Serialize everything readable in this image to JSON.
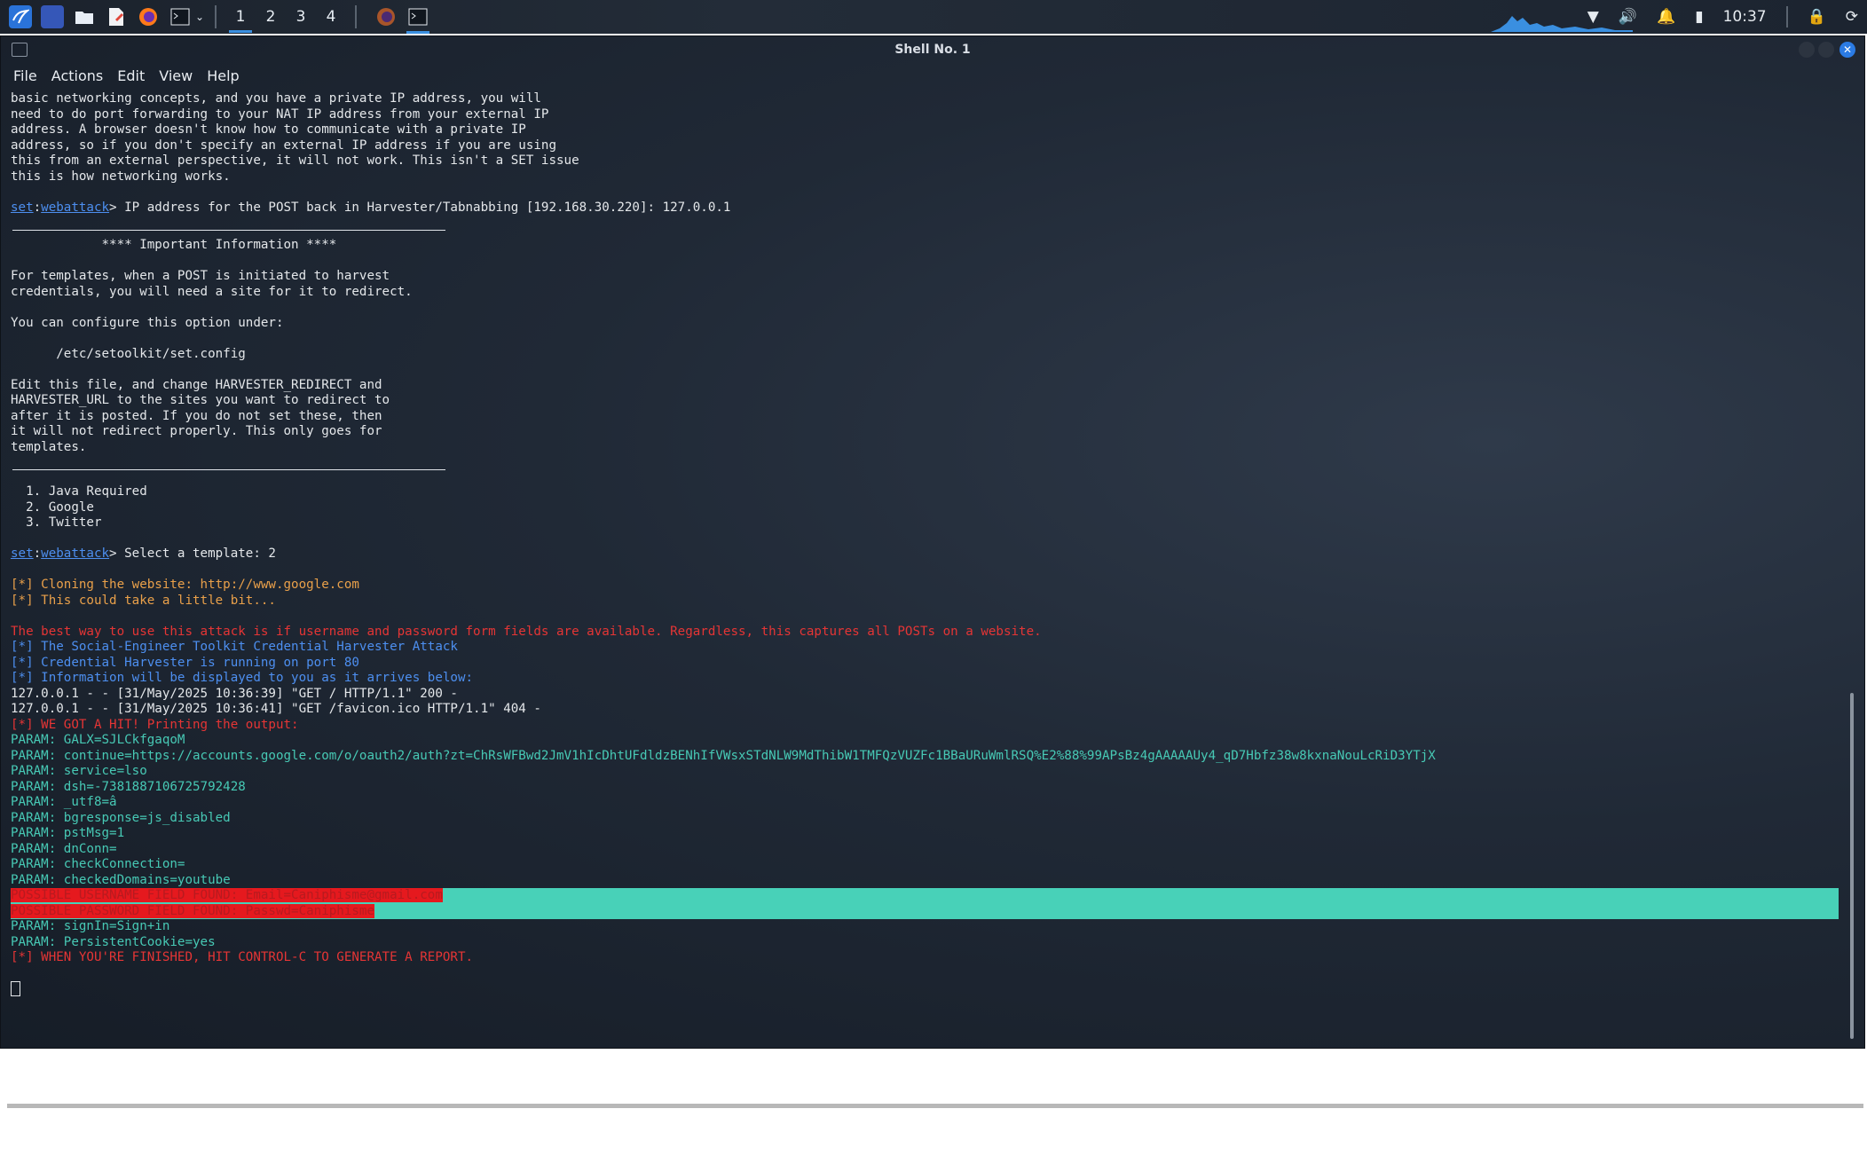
{
  "taskbar": {
    "workspaces": [
      "1",
      "2",
      "3",
      "4"
    ],
    "time": "10:37"
  },
  "window": {
    "title": "Shell No. 1",
    "menu": [
      "File",
      "Actions",
      "Edit",
      "View",
      "Help"
    ]
  },
  "terminal": {
    "intro": [
      "basic networking concepts, and you have a private IP address, you will",
      "need to do port forwarding to your NAT IP address from your external IP",
      "address. A browser doesn't know how to communicate with a private IP",
      "address, so if you don't specify an external IP address if you are using",
      "this from an external perspective, it will not work. This isn't a SET issue",
      "this is how networking works."
    ],
    "prompt_set": "set",
    "prompt_webattack": "webattack",
    "ip_prompt_text": "> IP address for the POST back in Harvester/Tabnabbing [192.168.30.220]: 127.0.0.1",
    "important_header": "            **** Important Information ****",
    "info_1": "For templates, when a POST is initiated to harvest",
    "info_2": "credentials, you will need a site for it to redirect.",
    "info_3": "You can configure this option under:",
    "config_path": "      /etc/setoolkit/set.config",
    "edit_lines": [
      "Edit this file, and change HARVESTER_REDIRECT and",
      "HARVESTER_URL to the sites you want to redirect to",
      "after it is posted. If you do not set these, then",
      "it will not redirect properly. This only goes for",
      "templates."
    ],
    "templates": [
      "  1. Java Required",
      "  2. Google",
      "  3. Twitter"
    ],
    "select_prompt_text": "> Select a template: 2",
    "cloning_lines": [
      "[*] Cloning the website: http://www.google.com",
      "[*] This could take a little bit..."
    ],
    "best_way_line": "The best way to use this attack is if username and password form fields are available. Regardless, this captures all POSTs on a website.",
    "status_lines": [
      "[*] The Social-Engineer Toolkit Credential Harvester Attack",
      "[*] Credential Harvester is running on port 80",
      "[*] Information will be displayed to you as it arrives below:"
    ],
    "log_lines": [
      "127.0.0.1 - - [31/May/2025 10:36:39] \"GET / HTTP/1.1\" 200 -",
      "127.0.0.1 - - [31/May/2025 10:36:41] \"GET /favicon.ico HTTP/1.1\" 404 -"
    ],
    "hit_line": "[*] WE GOT A HIT! Printing the output:",
    "params": [
      "PARAM: GALX=SJLCkfgaqoM",
      "PARAM: continue=https://accounts.google.com/o/oauth2/auth?zt=ChRsWFBwd2JmV1hIcDhtUFdldzBENhIfVWsxSTdNLW9MdThibW1TMFQzVUZFc1BBaURuWmlRSQ%E2%88%99APsBz4gAAAAAUy4_qD7Hbfz38w8kxnaNouLcRiD3YTjX",
      "PARAM: service=lso",
      "PARAM: dsh=-7381887106725792428",
      "PARAM: _utf8=â",
      "PARAM: bgresponse=js_disabled",
      "PARAM: pstMsg=1",
      "PARAM: dnConn=",
      "PARAM: checkConnection=",
      "PARAM: checkedDomains=youtube"
    ],
    "found_username": "POSSIBLE USERNAME FIELD FOUND: Email=Caniphisme@gmail.com",
    "found_password": "POSSIBLE PASSWORD FIELD FOUND: Passwd=Caniphisme",
    "params_after": [
      "PARAM: signIn=Sign+in",
      "PARAM: PersistentCookie=yes"
    ],
    "finish_line": "[*] WHEN YOU'RE FINISHED, HIT CONTROL-C TO GENERATE A REPORT."
  }
}
